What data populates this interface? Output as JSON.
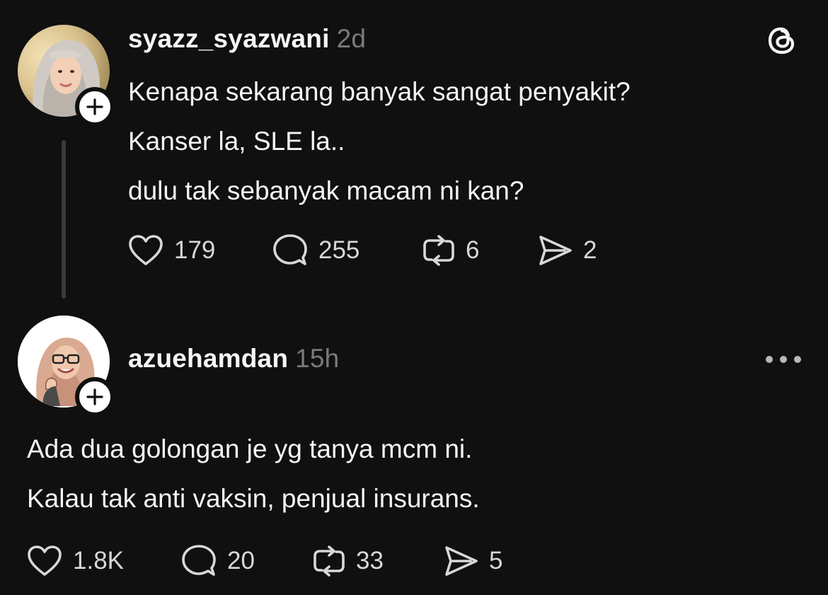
{
  "post": {
    "username": "syazz_syazwani",
    "time": "2d",
    "lines": [
      "Kenapa sekarang banyak sangat penyakit?",
      "Kanser la, SLE la..",
      "dulu tak sebanyak macam ni kan?"
    ],
    "stats": {
      "likes": "179",
      "replies": "255",
      "reposts": "6",
      "shares": "2"
    },
    "avatar_icon": "hijab-woman-avatar",
    "follow_icon": "plus-icon"
  },
  "reply": {
    "username": "azuehamdan",
    "time": "15h",
    "lines": [
      "Ada dua golongan je yg tanya mcm ni.",
      "Kalau tak anti vaksin, penjual insurans."
    ],
    "stats": {
      "likes": "1.8K",
      "replies": "20",
      "reposts": "33",
      "shares": "5"
    },
    "avatar_icon": "cartoon-hijab-woman-avatar",
    "follow_icon": "plus-icon"
  },
  "app": {
    "logo_icon": "threads-logo-icon",
    "more_icon": "more-options-icon"
  },
  "colors": {
    "background": "#101010",
    "text": "#f3f5f7",
    "muted": "#7a7a7a",
    "thread_line": "#3a3a3a"
  }
}
